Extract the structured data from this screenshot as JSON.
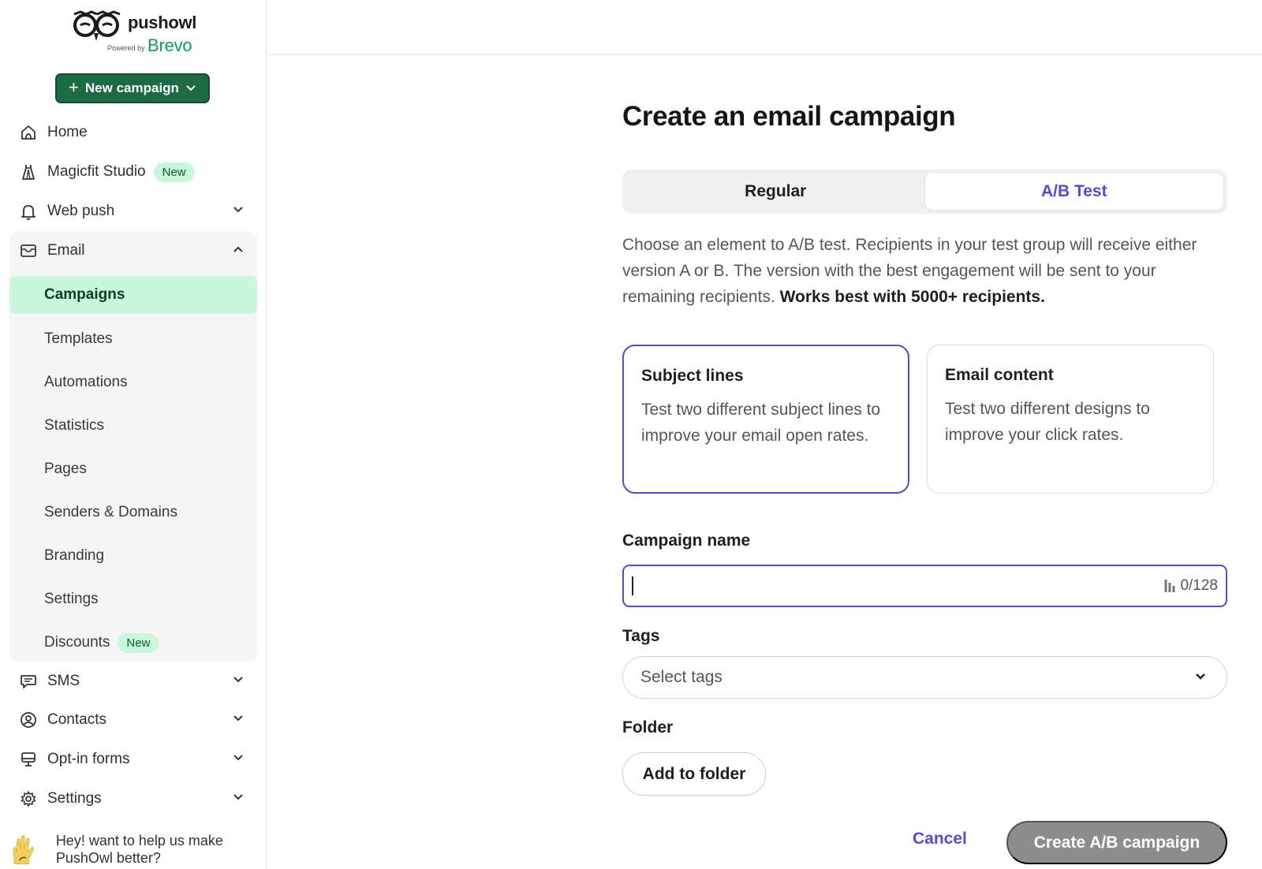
{
  "brand": {
    "name": "pushowl",
    "powered_by": "Powered by",
    "partner": "Brevo",
    "partner_color": "#0b996e"
  },
  "sidebar": {
    "new_campaign_label": "New campaign",
    "top_items": [
      {
        "label": "Home",
        "icon": "home-icon"
      },
      {
        "label": "Magicfit Studio",
        "icon": "dress-icon",
        "badge": "New"
      },
      {
        "label": "Web push",
        "icon": "bell-icon"
      },
      {
        "label": "Email",
        "icon": "mail-icon"
      }
    ],
    "email_subitems": [
      {
        "label": "Campaigns",
        "active": true
      },
      {
        "label": "Templates"
      },
      {
        "label": "Automations"
      },
      {
        "label": "Statistics"
      },
      {
        "label": "Pages"
      },
      {
        "label": "Senders & Domains"
      },
      {
        "label": "Branding"
      },
      {
        "label": "Settings"
      },
      {
        "label": "Discounts",
        "badge": "New"
      }
    ],
    "bottom_items": [
      {
        "label": "SMS",
        "icon": "chat-icon"
      },
      {
        "label": "Contacts",
        "icon": "user-circle-icon"
      },
      {
        "label": "Opt-in forms",
        "icon": "monitor-icon"
      },
      {
        "label": "Settings",
        "icon": "gear-icon"
      }
    ],
    "feedback_text": "Hey! want to help us make PushOwl better?"
  },
  "main": {
    "title": "Create an email campaign",
    "tabs": [
      {
        "label": "Regular",
        "selected": false
      },
      {
        "label": "A/B Test",
        "selected": true
      }
    ],
    "description": "Choose an element to A/B test. Recipients in your test group will receive either version A or B. The version with the best engagement will be sent to your remaining recipients.",
    "description_bold": "Works best with 5000+ recipients.",
    "options": [
      {
        "title": "Subject lines",
        "description": "Test two different subject lines to improve your email open rates.",
        "selected": true
      },
      {
        "title": "Email content",
        "description": "Test two different designs to improve your click rates.",
        "selected": false
      }
    ],
    "campaign_name_label": "Campaign name",
    "campaign_name_value": "",
    "campaign_name_counter": "0/128",
    "tags_label": "Tags",
    "tags_placeholder": "Select tags",
    "folder_label": "Folder",
    "add_to_folder_label": "Add to folder",
    "cancel_label": "Cancel",
    "create_label": "Create A/B campaign",
    "accent_color": "#5b46d6"
  }
}
